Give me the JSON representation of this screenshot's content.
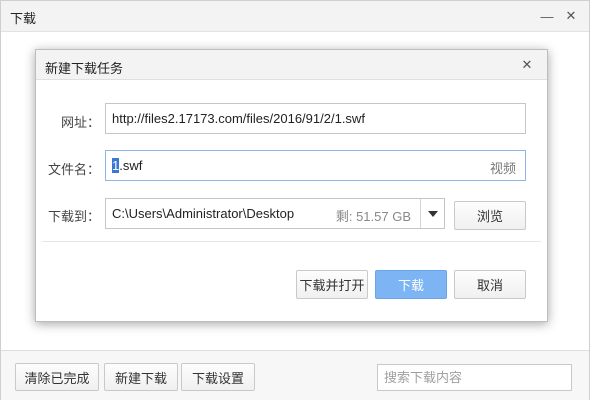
{
  "window": {
    "title": "下载",
    "minimize_glyph": "—",
    "close_glyph": "✕"
  },
  "footer": {
    "clear_completed": "清除已完成",
    "new_download": "新建下载",
    "download_settings": "下载设置",
    "search_placeholder": "搜索下载内容"
  },
  "dialog": {
    "title": "新建下载任务",
    "close_glyph": "✕",
    "url": {
      "label": "网址：",
      "value": "http://files2.17173.com/files/2016/91/2/1.swf"
    },
    "filename": {
      "label": "文件名：",
      "selected_part": "1",
      "rest": ".swf",
      "type": "视频"
    },
    "save_to": {
      "label": "下载到：",
      "path": "C:\\Users\\Administrator\\Desktop",
      "free_space": "剩: 51.57 GB",
      "browse": "浏览"
    },
    "buttons": {
      "download_and_open": "下载并打开",
      "download": "下载",
      "cancel": "取消"
    }
  },
  "colors": {
    "primary_button": "#7db4f3",
    "selection": "#3a78d8"
  },
  "icons": {
    "dropdown": "caret-down-icon"
  }
}
